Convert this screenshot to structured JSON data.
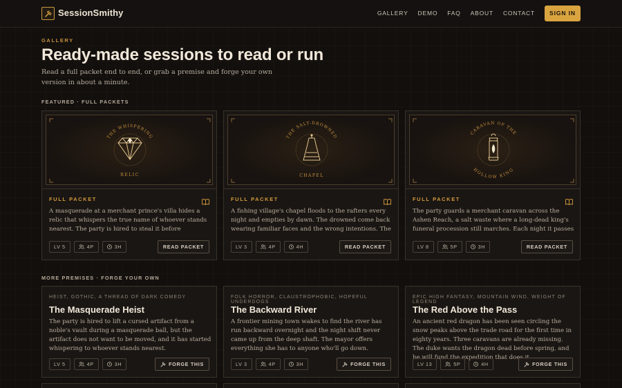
{
  "nav": {
    "brand": "SessionSmithy",
    "links": [
      "GALLERY",
      "DEMO",
      "FAQ",
      "ABOUT",
      "CONTACT"
    ],
    "signin": "SIGN IN"
  },
  "header": {
    "eyebrow": "GALLERY",
    "title": "Ready-made sessions to read or run",
    "lede": "Read a full packet end to end, or grab a premise and forge your own version in about a minute."
  },
  "featured": {
    "label": "FEATURED · FULL PACKETS",
    "cards": [
      {
        "art_top": "THE WHISPERING",
        "art_bottom": "RELIC",
        "kind": "FULL PACKET",
        "desc": "A masquerade at a merchant prince's villa hides a relic that whispers the true name of whoever stands nearest. The party is hired to steal it before midnight. The relic would...",
        "level": "LV 5",
        "players": "4P",
        "hours": "3H",
        "action": "READ PACKET",
        "icon": "diamond-icon"
      },
      {
        "art_top": "THE SALT-DROWNED",
        "art_bottom": "CHAPEL",
        "kind": "FULL PACKET",
        "desc": "A fishing village's chapel floods to the rafters every night and empties by dawn. The drowned come back wearing familiar faces and the wrong intentions. The party arrives...",
        "level": "LV 3",
        "players": "4P",
        "hours": "4H",
        "action": "READ PACKET",
        "icon": "bell-icon"
      },
      {
        "art_top": "CARAVAN OF THE",
        "art_bottom": "HOLLOW KING",
        "kind": "FULL PACKET",
        "desc": "The party guards a merchant caravan across the Ashen Reach, a salt waste where a long-dead king's funeral procession still marches. Each night it passes closer, and...",
        "level": "LV 8",
        "players": "5P",
        "hours": "3H",
        "action": "READ PACKET",
        "icon": "lantern-icon"
      }
    ]
  },
  "premises": {
    "label": "MORE PREMISES · FORGE YOUR OWN",
    "cards": [
      {
        "tags": "HEIST, GOTHIC, A THREAD OF DARK COMEDY",
        "title": "The Masquerade Heist",
        "desc": "The party is hired to lift a cursed artifact from a noble's vault during a masquerade ball, but the artifact does not want to be moved, and it has started whispering to whoever stands nearest.",
        "level": "LV 5",
        "players": "4P",
        "hours": "3H",
        "action": "FORGE THIS"
      },
      {
        "tags": "FOLK HORROR, CLAUSTROPHOBIC, HOPEFUL UNDERDOGS",
        "title": "The Backward River",
        "desc": "A frontier mining town wakes to find the river has run backward overnight and the night shift never came up from the deep shaft. The mayor offers everything she has to anyone who'll go down.",
        "level": "LV 3",
        "players": "4P",
        "hours": "3H",
        "action": "FORGE THIS"
      },
      {
        "tags": "EPIC HIGH FANTASY, MOUNTAIN WIND, WEIGHT OF LEGEND",
        "title": "The Red Above the Pass",
        "desc": "An ancient red dragon has been seen circling the snow peaks above the trade road for the first time in eighty years. Three caravans are already missing. The duke wants the dragon dead before spring, and he will fund the expedition that does it.",
        "level": "LV 13",
        "players": "5P",
        "hours": "4H",
        "action": "FORGE THIS"
      }
    ]
  },
  "colors": {
    "accent": "#d9a440",
    "background": "#120f0d",
    "card": "#1a1613"
  }
}
